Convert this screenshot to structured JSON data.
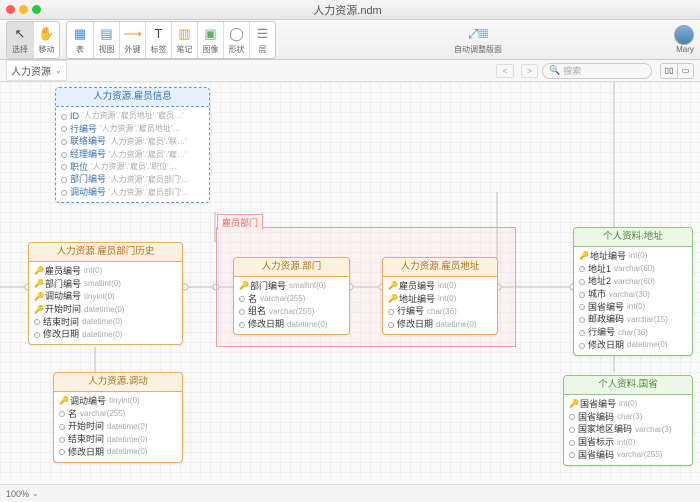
{
  "titlebar": {
    "title": "人力资源.ndm"
  },
  "toolbar": {
    "select": "选择",
    "move": "移动",
    "table": "表",
    "view": "视图",
    "fk": "外键",
    "label": "标签",
    "note": "笔记",
    "image": "图像",
    "shape": "形状",
    "layer": "层",
    "autoresize": "自动调整版面"
  },
  "user": {
    "name": "Mary"
  },
  "subbar": {
    "breadcrumb": "人力资源",
    "search_placeholder": "搜索",
    "nav_back": "<",
    "nav_fwd": ">"
  },
  "region": {
    "label": "雇员部门"
  },
  "entities": {
    "info": {
      "title": "人力资源.雇员信息",
      "rows": [
        {
          "k": false,
          "name": "ID",
          "type": "'人力资源'.'雇员地址'.'雇员…'"
        },
        {
          "k": false,
          "name": "行编号",
          "type": "'人力资源'.'雇员地址'…"
        },
        {
          "k": false,
          "name": "联络编号",
          "type": "'人力资源'.'雇员'.'联…'"
        },
        {
          "k": false,
          "name": "经理编号",
          "type": "'人力资源'.'雇员'.'雇…'"
        },
        {
          "k": false,
          "name": "职位",
          "type": "'人力资源'.'雇员'.'职位'…"
        },
        {
          "k": false,
          "name": "部门编号",
          "type": "'人力资源'.'雇员部门'…"
        },
        {
          "k": false,
          "name": "调动编号",
          "type": "'人力资源'.'雇员部门'…"
        }
      ]
    },
    "history": {
      "title": "人力资源.雇员部门历史",
      "rows": [
        {
          "k": true,
          "name": "雇员编号",
          "type": "int(0)"
        },
        {
          "k": true,
          "name": "部门编号",
          "type": "smallint(0)"
        },
        {
          "k": true,
          "name": "调动编号",
          "type": "tinyint(0)"
        },
        {
          "k": true,
          "name": "开始时间",
          "type": "datetime(0)"
        },
        {
          "k": false,
          "name": "结束时间",
          "type": "datetime(0)"
        },
        {
          "k": false,
          "name": "修改日期",
          "type": "datetime(0)"
        }
      ]
    },
    "dept": {
      "title": "人力资源.部门",
      "rows": [
        {
          "k": true,
          "name": "部门编号",
          "type": "smallint(0)"
        },
        {
          "k": false,
          "name": "名",
          "type": "varchar(255)"
        },
        {
          "k": false,
          "name": "组名",
          "type": "varchar(255)"
        },
        {
          "k": false,
          "name": "修改日期",
          "type": "datetime(0)"
        }
      ]
    },
    "empaddr": {
      "title": "人力资源.雇员地址",
      "rows": [
        {
          "k": true,
          "name": "雇员编号",
          "type": "int(0)"
        },
        {
          "k": true,
          "name": "地址编号",
          "type": "int(0)"
        },
        {
          "k": false,
          "name": "行编号",
          "type": "char(36)"
        },
        {
          "k": false,
          "name": "修改日期",
          "type": "datetime(0)"
        }
      ]
    },
    "shift": {
      "title": "人力资源.调动",
      "rows": [
        {
          "k": true,
          "name": "调动编号",
          "type": "tinyint(0)"
        },
        {
          "k": false,
          "name": "名",
          "type": "varchar(255)"
        },
        {
          "k": false,
          "name": "开始时间",
          "type": "datetime(0)"
        },
        {
          "k": false,
          "name": "结束时间",
          "type": "datetime(0)"
        },
        {
          "k": false,
          "name": "修改日期",
          "type": "datetime(0)"
        }
      ]
    },
    "addr": {
      "title": "个人资料.地址",
      "rows": [
        {
          "k": true,
          "name": "地址编号",
          "type": "int(0)"
        },
        {
          "k": false,
          "name": "地址1",
          "type": "varchar(60)"
        },
        {
          "k": false,
          "name": "地址2",
          "type": "varchar(60)"
        },
        {
          "k": false,
          "name": "城市",
          "type": "varchar(30)"
        },
        {
          "k": false,
          "name": "国省编号",
          "type": "int(0)"
        },
        {
          "k": false,
          "name": "邮政编码",
          "type": "varchar(15)"
        },
        {
          "k": false,
          "name": "行编号",
          "type": "char(36)"
        },
        {
          "k": false,
          "name": "修改日期",
          "type": "datetime(0)"
        }
      ]
    },
    "prov": {
      "title": "个人资料.国省",
      "rows": [
        {
          "k": true,
          "name": "国省编号",
          "type": "int(0)"
        },
        {
          "k": false,
          "name": "国省编码",
          "type": "char(3)"
        },
        {
          "k": false,
          "name": "国家地区编码",
          "type": "varchar(3)"
        },
        {
          "k": false,
          "name": "国省标示",
          "type": "int(0)"
        },
        {
          "k": false,
          "name": "国省编码",
          "type": "varchar(255)"
        }
      ]
    }
  },
  "status": {
    "zoom": "100%"
  }
}
